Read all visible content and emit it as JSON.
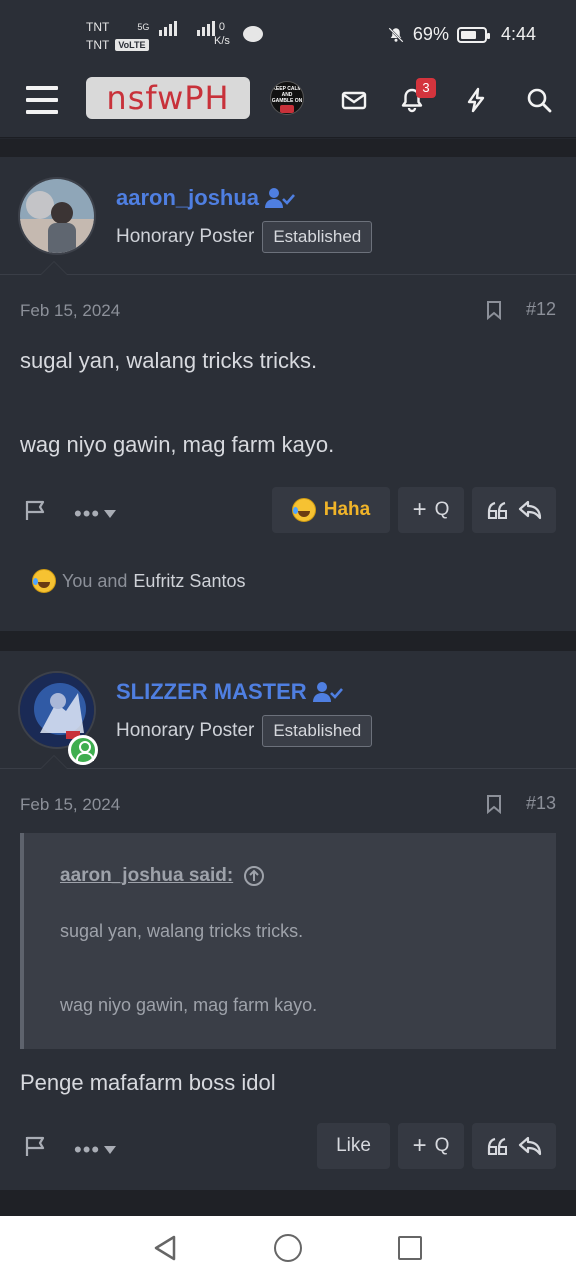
{
  "status_bar": {
    "carrier1": "TNT",
    "carrier2": "TNT",
    "volte": "VoLTE",
    "net": "5G",
    "speed_value": "0",
    "speed_unit": "K/s",
    "battery": "69%",
    "battery_level": 0.69,
    "time": "4:44"
  },
  "header": {
    "logo": "nsfwPH",
    "keep_calm_text": "KEEP CALM AND GAMBLE ON",
    "notification_count": "3"
  },
  "posts": [
    {
      "username": "aaron_joshua",
      "user_title": "Honorary Poster",
      "banner": "Established",
      "date": "Feb 15, 2024",
      "post_number": "#12",
      "lines": [
        "sugal yan, walang tricks tricks.",
        "wag niyo gawin, mag farm kayo."
      ],
      "reaction_button": "Haha",
      "quote_button": "Q",
      "reactions_prefix": "You and",
      "reactions_name": "Eufritz Santos"
    },
    {
      "username": "SLIZZER MASTER",
      "user_title": "Honorary Poster",
      "banner": "Established",
      "date": "Feb 15, 2024",
      "post_number": "#13",
      "quote_author": "aaron_joshua said:",
      "quote_lines": [
        "sugal yan, walang tricks tricks.",
        "wag niyo gawin, mag farm kayo."
      ],
      "body": "Penge mafafarm boss idol",
      "reaction_button": "Like",
      "quote_button": "Q"
    }
  ],
  "colors": {
    "background": "#24272e",
    "panel": "#2b2f37",
    "username": "#4f7fe1",
    "haha": "#f0b429",
    "badge": "#d4343d",
    "online": "#3fae4f"
  }
}
